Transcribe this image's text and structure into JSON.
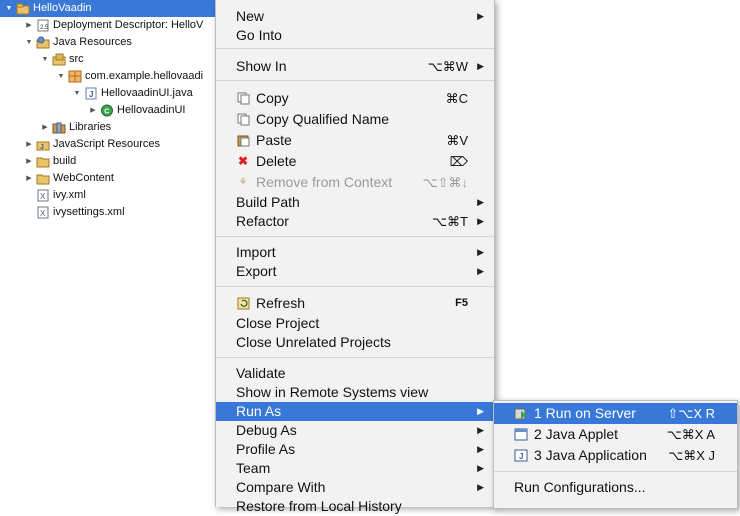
{
  "tree": {
    "items": [
      {
        "label": "HelloVaadin",
        "icon": "project-icon",
        "expanded": true,
        "selected": true
      },
      {
        "label": "Deployment Descriptor: HelloV",
        "icon": "deployment-descriptor-icon",
        "expanded": false
      },
      {
        "label": "Java Resources",
        "icon": "java-resources-icon",
        "expanded": true
      },
      {
        "label": "src",
        "icon": "source-folder-icon",
        "expanded": true
      },
      {
        "label": "com.example.hellovaadi",
        "icon": "package-icon",
        "expanded": true
      },
      {
        "label": "HellovaadinUI.java",
        "icon": "java-file-icon",
        "expanded": true
      },
      {
        "label": "HellovaadinUI",
        "icon": "class-icon",
        "expanded": false
      },
      {
        "label": "Libraries",
        "icon": "libraries-icon",
        "expanded": false
      },
      {
        "label": "JavaScript Resources",
        "icon": "javascript-resources-icon",
        "expanded": false
      },
      {
        "label": "build",
        "icon": "folder-icon",
        "expanded": false
      },
      {
        "label": "WebContent",
        "icon": "folder-icon",
        "expanded": false
      },
      {
        "label": "ivy.xml",
        "icon": "xml-file-icon"
      },
      {
        "label": "ivysettings.xml",
        "icon": "xml-file-icon"
      }
    ]
  },
  "context_menu": {
    "items": [
      {
        "label": "New",
        "arrow": true
      },
      {
        "label": "Go Into"
      },
      {
        "label": "Show In",
        "shortcut": "⌥⌘W",
        "arrow": true
      },
      {
        "label": "Copy",
        "shortcut": "⌘C",
        "icon": "copy-icon"
      },
      {
        "label": "Copy Qualified Name",
        "icon": "copy-qualified-name-icon"
      },
      {
        "label": "Paste",
        "shortcut": "⌘V",
        "icon": "paste-icon"
      },
      {
        "label": "Delete",
        "shortcut": "⌦",
        "icon": "delete-icon"
      },
      {
        "label": "Remove from Context",
        "shortcut": "⌥⇧⌘↓",
        "icon": "remove-context-icon",
        "disabled": true
      },
      {
        "label": "Build Path",
        "arrow": true
      },
      {
        "label": "Refactor",
        "shortcut": "⌥⌘T",
        "arrow": true
      },
      {
        "label": "Import",
        "arrow": true
      },
      {
        "label": "Export",
        "arrow": true
      },
      {
        "label": "Refresh",
        "shortcut": "F5",
        "icon": "refresh-icon"
      },
      {
        "label": "Close Project"
      },
      {
        "label": "Close Unrelated Projects"
      },
      {
        "label": "Validate"
      },
      {
        "label": "Show in Remote Systems view"
      },
      {
        "label": "Run As",
        "arrow": true,
        "highlighted": true
      },
      {
        "label": "Debug As",
        "arrow": true
      },
      {
        "label": "Profile As",
        "arrow": true
      },
      {
        "label": "Team",
        "arrow": true
      },
      {
        "label": "Compare With",
        "arrow": true
      },
      {
        "label": "Restore from Local History"
      }
    ]
  },
  "submenu": {
    "items": [
      {
        "label": "1 Run on Server",
        "shortcut": "⇧⌥X R",
        "icon": "run-on-server-icon",
        "highlighted": true
      },
      {
        "label": "2 Java Applet",
        "shortcut": "⌥⌘X A",
        "icon": "java-applet-icon"
      },
      {
        "label": "3 Java Application",
        "shortcut": "⌥⌘X J",
        "icon": "java-application-icon"
      },
      {
        "label": "Run Configurations..."
      }
    ]
  },
  "colors": {
    "selection": "#3878d8",
    "menu_bg": "#f2f2f2"
  }
}
